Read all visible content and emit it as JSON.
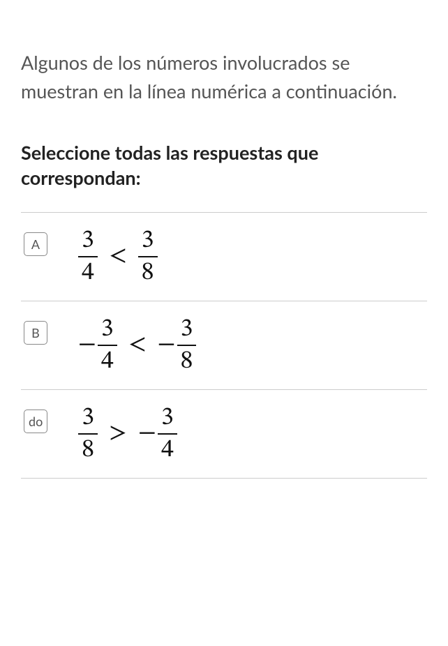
{
  "intro": "Algunos de los números involucrados se muestran en la línea numérica a continuación.",
  "instruction": "Seleccione todas las respuestas que correspondan:",
  "options": [
    {
      "label": "A",
      "left": {
        "negative": false,
        "num": "3",
        "den": "4"
      },
      "operator": "<",
      "right": {
        "negative": false,
        "num": "3",
        "den": "8"
      }
    },
    {
      "label": "B",
      "left": {
        "negative": true,
        "num": "3",
        "den": "4"
      },
      "operator": "<",
      "right": {
        "negative": true,
        "num": "3",
        "den": "8"
      }
    },
    {
      "label": "do",
      "left": {
        "negative": false,
        "num": "3",
        "den": "8"
      },
      "operator": ">",
      "right": {
        "negative": true,
        "num": "3",
        "den": "4"
      }
    }
  ]
}
